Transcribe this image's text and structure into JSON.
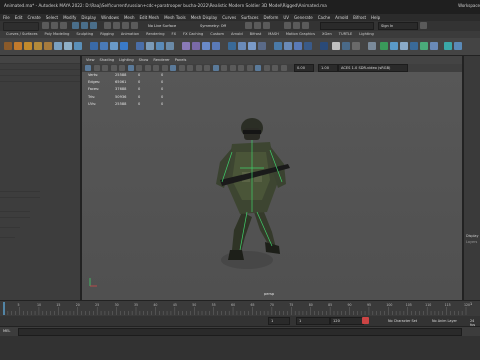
{
  "window": {
    "title": "Animated.ma* - Autodesk MAYA 2022: D:\\Raaj\\Self\\current\\russian+cdc+paratrooper bucha-2022\\Realistic Modern Soldier 3D Model\\Rigged\\Animated.ma",
    "workspace": "Workspace"
  },
  "menu": [
    "File",
    "Edit",
    "Create",
    "Select",
    "Modify",
    "Display",
    "Windows",
    "Mesh",
    "Edit Mesh",
    "Mesh Tools",
    "Mesh Display",
    "Curves",
    "Surfaces",
    "Deform",
    "UV",
    "Generate",
    "Cache",
    "Arnold",
    "Bifrost",
    "Help"
  ],
  "status": {
    "no_live_surface": "No Live Surface",
    "symmetry": "Symmetry: Off",
    "sign_in": "Sign In"
  },
  "shelf_tabs": [
    "Curves / Surfaces",
    "Poly Modeling",
    "Sculpting",
    "Rigging",
    "Animation",
    "Rendering",
    "FX",
    "FX Caching",
    "Custom",
    "Arnold",
    "Bifrost",
    "MASH",
    "Motion Graphics",
    "XGen",
    "TURTLE",
    "Lighting"
  ],
  "viewport": {
    "menu": [
      "View",
      "Shading",
      "Lighting",
      "Show",
      "Renderer",
      "Panels"
    ],
    "toolbar": {
      "field_a": "0.00",
      "field_b": "1.00",
      "colorspace": "ACES 1.0 SDR-video (sRGB)"
    },
    "hud": [
      {
        "label": "Verts:",
        "v1": "25588",
        "v2": "0",
        "v3": "0"
      },
      {
        "label": "Edges:",
        "v1": "65061",
        "v2": "0",
        "v3": "0"
      },
      {
        "label": "Faces:",
        "v1": "37688",
        "v2": "0",
        "v3": "0"
      },
      {
        "label": "Tris:",
        "v1": "50936",
        "v2": "0",
        "v3": "0"
      },
      {
        "label": "UVs:",
        "v1": "25588",
        "v2": "0",
        "v3": "0"
      }
    ],
    "camera": "persp"
  },
  "right_panel": {
    "display_label": "Display",
    "layers_label": "Layers"
  },
  "timeline": {
    "ticks": [
      "5",
      "10",
      "15",
      "20",
      "25",
      "30",
      "35",
      "40",
      "45",
      "50",
      "55",
      "60",
      "65",
      "70",
      "75",
      "80",
      "85",
      "90",
      "95",
      "100",
      "105",
      "110",
      "115",
      "120"
    ],
    "current_frame": "1",
    "end_frame": "120"
  },
  "range": {
    "start": "1",
    "inner_start": "1",
    "inner_end": "120",
    "end": "200",
    "character_set": "No Character Set",
    "anim_layer": "No Anim Layer",
    "fps": "24 fps"
  },
  "cmdline": {
    "mel": "MEL"
  },
  "colors": {
    "accent": "#5285a6",
    "viewport_bg": "#555555",
    "key_red": "#c44",
    "curve_green": "#3fd06a"
  }
}
